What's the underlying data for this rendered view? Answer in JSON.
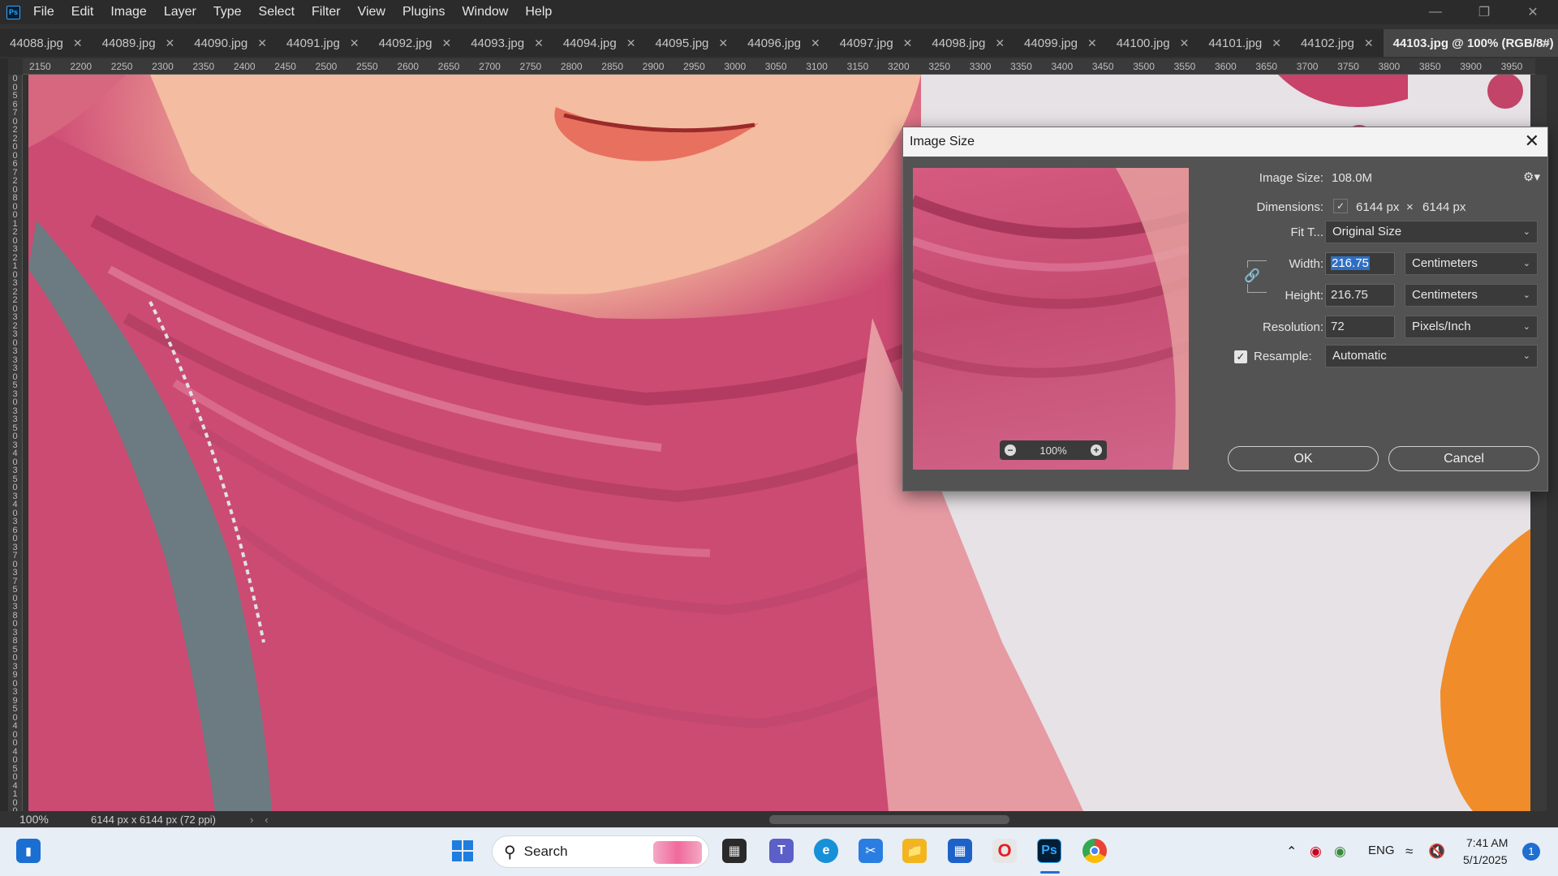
{
  "menubar": {
    "items": [
      "File",
      "Edit",
      "Image",
      "Layer",
      "Type",
      "Select",
      "Filter",
      "View",
      "Plugins",
      "Window",
      "Help"
    ],
    "app_icon": "Ps"
  },
  "tabs": [
    {
      "label": "44088.jpg"
    },
    {
      "label": "44089.jpg"
    },
    {
      "label": "44090.jpg"
    },
    {
      "label": "44091.jpg"
    },
    {
      "label": "44092.jpg"
    },
    {
      "label": "44093.jpg"
    },
    {
      "label": "44094.jpg"
    },
    {
      "label": "44095.jpg"
    },
    {
      "label": "44096.jpg"
    },
    {
      "label": "44097.jpg"
    },
    {
      "label": "44098.jpg"
    },
    {
      "label": "44099.jpg"
    },
    {
      "label": "44100.jpg"
    },
    {
      "label": "44101.jpg"
    },
    {
      "label": "44102.jpg"
    },
    {
      "label": "44103.jpg @ 100% (RGB/8#)",
      "active": true
    }
  ],
  "ruler": {
    "h_ticks": [
      "2150",
      "2200",
      "2250",
      "2300",
      "2350",
      "2400",
      "2450",
      "2500",
      "2550",
      "2600",
      "2650",
      "2700",
      "2750",
      "2800",
      "2850",
      "2900",
      "2950",
      "3000",
      "3050",
      "3100",
      "3150",
      "3200",
      "3250",
      "3300",
      "3350",
      "3400",
      "3450",
      "3500",
      "3550",
      "3600",
      "3650",
      "3700",
      "3750",
      "3800",
      "3850",
      "3900",
      "3950"
    ]
  },
  "status": {
    "zoom": "100%",
    "doc_info": "6144 px x 6144 px (72 ppi)"
  },
  "dialog": {
    "title": "Image Size",
    "image_size_label": "Image Size:",
    "image_size_value": "108.0M",
    "dimensions_label": "Dimensions:",
    "dim_width": "6144 px",
    "dim_times": "×",
    "dim_height": "6144 px",
    "fit_to_label": "Fit T...",
    "fit_to_value": "Original Size",
    "width_label": "Width:",
    "width_value": "216.75",
    "width_unit": "Centimeters",
    "height_label": "Height:",
    "height_value": "216.75",
    "height_unit": "Centimeters",
    "resolution_label": "Resolution:",
    "resolution_value": "72",
    "resolution_unit": "Pixels/Inch",
    "resample_label": "Resample:",
    "resample_checked": true,
    "resample_value": "Automatic",
    "preview_zoom": "100%",
    "ok_label": "OK",
    "cancel_label": "Cancel"
  },
  "taskbar": {
    "search_label": "Search",
    "tray_lang": "ENG",
    "time": "7:41 AM",
    "date": "5/1/2025",
    "notification_count": "1"
  },
  "colors": {
    "ps_blue": "#31a8ff",
    "scarf_pink": "#c9486f",
    "skin": "#f3b79c"
  }
}
